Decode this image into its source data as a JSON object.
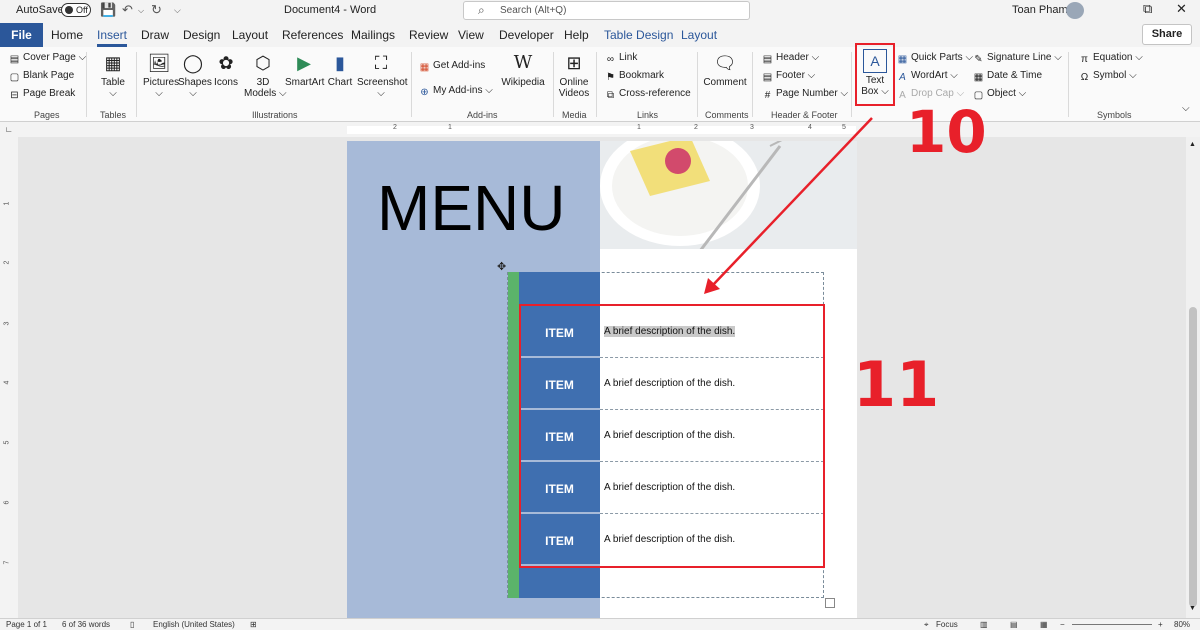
{
  "titlebar": {
    "autosave_label": "AutoSave",
    "autosave_state": "Off",
    "document_title": "Document4  -  Word",
    "search_placeholder": "Search (Alt+Q)",
    "user_name": "Toan Pham"
  },
  "tabs": {
    "file": "File",
    "items": [
      "Home",
      "Insert",
      "Draw",
      "Design",
      "Layout",
      "References",
      "Mailings",
      "Review",
      "View",
      "Developer",
      "Help",
      "Table Design",
      "Layout"
    ],
    "active": "Insert",
    "share": "Share"
  },
  "ribbon": {
    "pages": {
      "label": "Pages",
      "items": [
        "Cover Page",
        "Blank Page",
        "Page Break"
      ]
    },
    "tables": {
      "label": "Tables",
      "table": "Table"
    },
    "illustrations": {
      "label": "Illustrations",
      "pictures": "Pictures",
      "shapes": "Shapes",
      "icons": "Icons",
      "models_line1": "3D",
      "models_line2": "Models",
      "smartart": "SmartArt",
      "chart": "Chart",
      "screenshot": "Screenshot"
    },
    "addins": {
      "label": "Add-ins",
      "get": "Get Add-ins",
      "my": "My Add-ins",
      "wikipedia": "Wikipedia"
    },
    "media": {
      "label": "Media",
      "video_line1": "Online",
      "video_line2": "Videos"
    },
    "links": {
      "label": "Links",
      "link": "Link",
      "bookmark": "Bookmark",
      "crossref": "Cross-reference"
    },
    "comments": {
      "label": "Comments",
      "comment": "Comment"
    },
    "headerfooter": {
      "label": "Header & Footer",
      "header": "Header",
      "footer": "Footer",
      "pagenumber": "Page Number"
    },
    "text": {
      "textbox_line1": "Text",
      "textbox_line2": "Box",
      "quickparts": "Quick Parts",
      "wordart": "WordArt",
      "dropcap": "Drop Cap",
      "signature": "Signature Line",
      "datetime": "Date & Time",
      "object": "Object"
    },
    "symbols": {
      "label": "Symbols",
      "equation": "Equation",
      "symbol": "Symbol"
    }
  },
  "ruler": {
    "h_numbers": [
      "2",
      "1",
      "1",
      "2",
      "3",
      "4",
      "5"
    ],
    "v_numbers": [
      "1",
      "2",
      "3",
      "4",
      "5",
      "6",
      "7"
    ]
  },
  "document": {
    "menu_title": "MENU",
    "rows": [
      {
        "item": "ITEM",
        "description": "A brief description of the dish."
      },
      {
        "item": "ITEM",
        "description": "A brief description of the dish."
      },
      {
        "item": "ITEM",
        "description": "A brief description of the dish."
      },
      {
        "item": "ITEM",
        "description": "A brief description of the dish."
      },
      {
        "item": "ITEM",
        "description": "A brief description of the dish."
      }
    ]
  },
  "statusbar": {
    "page": "Page 1 of 1",
    "words": "6 of 36 words",
    "language": "English (United States)",
    "focus": "Focus",
    "zoom": "80%"
  },
  "annotations": {
    "step_a": "10",
    "step_b": "11"
  },
  "colors": {
    "accent": "#2b579a",
    "highlight": "#e8202a",
    "menu_panel": "#a7bad8",
    "item_cell": "#3f6fb0",
    "green_strip": "#5bb36a"
  }
}
